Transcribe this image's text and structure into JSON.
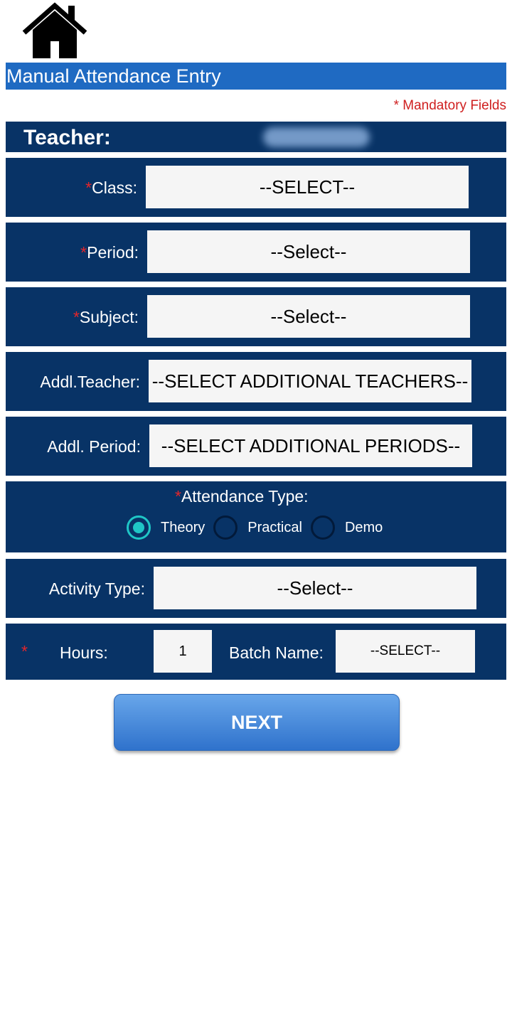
{
  "header": {
    "title": "Manual Attendance Entry",
    "mandatory_note": "* Mandatory Fields"
  },
  "icons": {
    "home": "home-icon"
  },
  "colors": {
    "accent": "#1f6ac2",
    "row_bg": "#083366",
    "required": "#e3262b",
    "radio_selected": "#1fc6c6"
  },
  "form": {
    "teacher_label": "Teacher:",
    "required_mark": "*",
    "class": {
      "label": "Class:",
      "value": "--SELECT--"
    },
    "period": {
      "label": "Period:",
      "value": "--Select--"
    },
    "subject": {
      "label": "Subject:",
      "value": "--Select--"
    },
    "addl_teacher": {
      "label": "Addl.Teacher:",
      "value": "--SELECT ADDITIONAL TEACHERS--"
    },
    "addl_period": {
      "label": "Addl. Period:",
      "value": "--SELECT ADDITIONAL PERIODS--"
    },
    "attendance_type": {
      "label": "Attendance Type:",
      "options": [
        "Theory",
        "Practical",
        "Demo"
      ],
      "selected": "Theory"
    },
    "activity_type": {
      "label": "Activity Type:",
      "value": "--Select--"
    },
    "hours": {
      "label": "Hours:",
      "value": "1"
    },
    "batch_name": {
      "label": "Batch Name:",
      "value": "--SELECT--"
    }
  },
  "actions": {
    "next_label": "NEXT"
  }
}
